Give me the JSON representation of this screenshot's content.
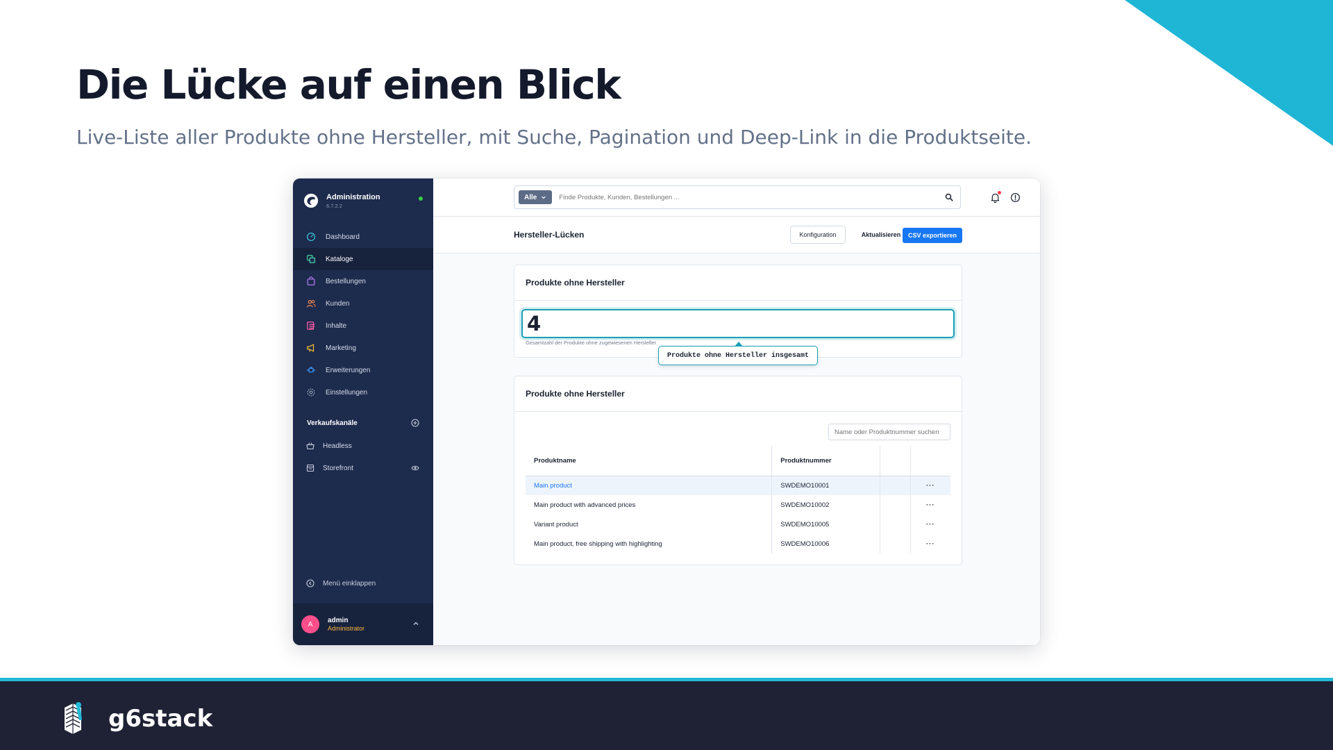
{
  "slide": {
    "title": "Die Lücke auf einen Blick",
    "subtitle": "Live-Liste aller Produkte ohne Hersteller, mit Suche, Pagination und Deep-Link in die Produktseite.",
    "footer_brand": "g6stack",
    "accent_color": "#23b8d6",
    "footer_bg": "#1f2235"
  },
  "sidebar": {
    "brand_name": "Administration",
    "brand_version": "6.7.2.2",
    "nav": [
      {
        "label": "Dashboard",
        "icon": "gauge-icon",
        "color": "#3bc7dc"
      },
      {
        "label": "Kataloge",
        "icon": "catalog-icon",
        "color": "#4bd6a6",
        "active": true
      },
      {
        "label": "Bestellungen",
        "icon": "bag-icon",
        "color": "#b47cf2"
      },
      {
        "label": "Kunden",
        "icon": "users-icon",
        "color": "#ff8a4c"
      },
      {
        "label": "Inhalte",
        "icon": "content-icon",
        "color": "#ff5ca8"
      },
      {
        "label": "Marketing",
        "icon": "megaphone-icon",
        "color": "#ffc12e"
      },
      {
        "label": "Erweiterungen",
        "icon": "plug-icon",
        "color": "#3d9cff"
      },
      {
        "label": "Einstellungen",
        "icon": "gear-icon",
        "color": "#9aa6ba"
      }
    ],
    "channels_title": "Verkaufskanäle",
    "channels": [
      {
        "label": "Headless",
        "icon": "basket-icon"
      },
      {
        "label": "Storefront",
        "icon": "storefront-icon"
      }
    ],
    "collapse_label": "Menü einklappen",
    "user": {
      "initial": "A",
      "name": "admin",
      "role": "Administrator"
    }
  },
  "topbar": {
    "search_type": "Alle",
    "search_placeholder": "Finde Produkte, Kunden, Bestellungen ..."
  },
  "page": {
    "title": "Hersteller-Lücken",
    "btn_config": "Konfiguration",
    "btn_refresh": "Aktualisieren",
    "btn_export": "CSV exportieren"
  },
  "kpi_card": {
    "title": "Produkte ohne Hersteller",
    "value": "4",
    "caption": "Gesamtzahl der Produkte ohne zugewiesenen Hersteller",
    "tooltip": "Produkte ohne Hersteller insgesamt"
  },
  "list_card": {
    "title": "Produkte ohne Hersteller",
    "search_placeholder": "Name oder Produktnummer suchen",
    "columns": [
      "Produktname",
      "Produktnummer"
    ],
    "rows": [
      {
        "name": "Main product",
        "number": "SWDEMO10001",
        "action": "···"
      },
      {
        "name": "Main product with advanced prices",
        "number": "SWDEMO10002",
        "action": "···"
      },
      {
        "name": "Variant product",
        "number": "SWDEMO10005",
        "action": "···"
      },
      {
        "name": "Main product, free shipping with highlighting",
        "number": "SWDEMO10006",
        "action": "···"
      }
    ]
  }
}
